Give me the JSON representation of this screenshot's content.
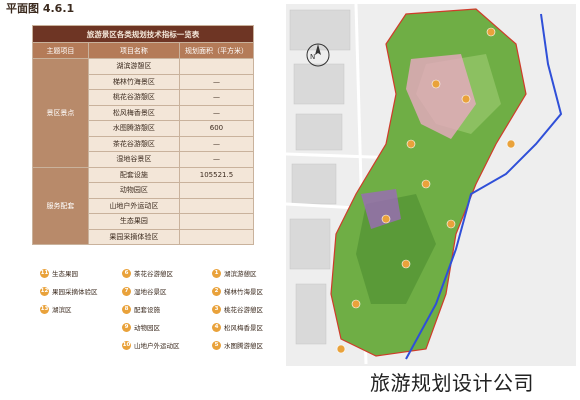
{
  "page": {
    "title": "平面图 4.6.1"
  },
  "table": {
    "caption": "旅游景区各类规划技术指标一览表",
    "headers": [
      "主题项目",
      "项目名称",
      "规划面积（平方米）"
    ],
    "groups": [
      {
        "name": "景区景点",
        "rows": [
          {
            "name": "湖滨游憩区",
            "area": ""
          },
          {
            "name": "梯林竹海景区",
            "area": "—"
          },
          {
            "name": "桃花谷游憩区",
            "area": "—"
          },
          {
            "name": "松风梅香景区",
            "area": "—"
          },
          {
            "name": "水图腾游憩区",
            "area": "600"
          },
          {
            "name": "茶花谷游憩区",
            "area": "—"
          },
          {
            "name": "湿地谷景区",
            "area": "—"
          }
        ]
      },
      {
        "name": "服务配套",
        "rows": [
          {
            "name": "配套设施",
            "area": "105521.5"
          },
          {
            "name": "动物园区",
            "area": ""
          },
          {
            "name": "山地户外运动区",
            "area": ""
          },
          {
            "name": "生态果园",
            "area": ""
          },
          {
            "name": "果园采摘体验区",
            "area": ""
          }
        ]
      }
    ]
  },
  "legend": {
    "items": [
      {
        "num": "1",
        "label": "湖滨游憩区"
      },
      {
        "num": "2",
        "label": "梯林竹海景区"
      },
      {
        "num": "3",
        "label": "桃花谷游憩区"
      },
      {
        "num": "4",
        "label": "松风梅香景区"
      },
      {
        "num": "5",
        "label": "水图腾游憩区"
      },
      {
        "num": "6",
        "label": "茶花谷游憩区"
      },
      {
        "num": "7",
        "label": "湿地谷景区"
      },
      {
        "num": "8",
        "label": "配套设施"
      },
      {
        "num": "9",
        "label": "动物园区"
      },
      {
        "num": "10",
        "label": "山地户外运动区"
      },
      {
        "num": "11",
        "label": "生态果园"
      },
      {
        "num": "12",
        "label": "果园采摘体验区"
      },
      {
        "num": "13",
        "label": "湖滨区"
      }
    ]
  },
  "map": {
    "north_label": "N"
  },
  "watermark": "旅游规划设计公司",
  "colors": {
    "table_caption": "#6e3524",
    "table_header": "#b47b58",
    "table_row": "#f3e6d8",
    "legend_marker": "#e9a23b",
    "park_green": "#6fae45",
    "boundary_blue": "#2f4fd8"
  }
}
